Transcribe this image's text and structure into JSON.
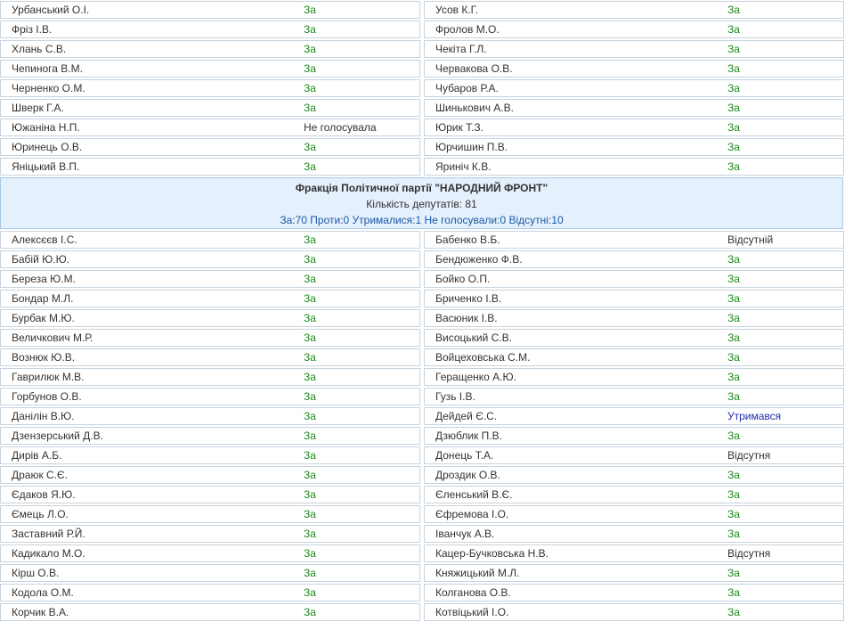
{
  "top_rows": [
    {
      "l_name": "Урбанський О.І.",
      "l_vote": "За",
      "l_type": "yes",
      "r_name": "Усов К.Г.",
      "r_vote": "За",
      "r_type": "yes"
    },
    {
      "l_name": "Фріз І.В.",
      "l_vote": "За",
      "l_type": "yes",
      "r_name": "Фролов М.О.",
      "r_vote": "За",
      "r_type": "yes"
    },
    {
      "l_name": "Хлань С.В.",
      "l_vote": "За",
      "l_type": "yes",
      "r_name": "Чекіта Г.Л.",
      "r_vote": "За",
      "r_type": "yes"
    },
    {
      "l_name": "Чепинога В.М.",
      "l_vote": "За",
      "l_type": "yes",
      "r_name": "Червакова О.В.",
      "r_vote": "За",
      "r_type": "yes"
    },
    {
      "l_name": "Черненко О.М.",
      "l_vote": "За",
      "l_type": "yes",
      "r_name": "Чубаров Р.А.",
      "r_vote": "За",
      "r_type": "yes"
    },
    {
      "l_name": "Шверк Г.А.",
      "l_vote": "За",
      "l_type": "yes",
      "r_name": "Шинькович А.В.",
      "r_vote": "За",
      "r_type": "yes"
    },
    {
      "l_name": "Южаніна Н.П.",
      "l_vote": "Не голосувала",
      "l_type": "none",
      "r_name": "Юрик Т.З.",
      "r_vote": "За",
      "r_type": "yes"
    },
    {
      "l_name": "Юринець О.В.",
      "l_vote": "За",
      "l_type": "yes",
      "r_name": "Юрчишин П.В.",
      "r_vote": "За",
      "r_type": "yes"
    },
    {
      "l_name": "Яніцький В.П.",
      "l_vote": "За",
      "l_type": "yes",
      "r_name": "Яриніч К.В.",
      "r_vote": "За",
      "r_type": "yes"
    }
  ],
  "faction": {
    "title": "Фракція Політичної партії \"НАРОДНИЙ ФРОНТ\"",
    "count": "Кількість депутатів: 81",
    "summary": "За:70 Проти:0 Утрималися:1 Не голосували:0 Відсутні:10"
  },
  "bottom_rows": [
    {
      "l_name": "Алексєєв І.С.",
      "l_vote": "За",
      "l_type": "yes",
      "r_name": "Бабенко В.Б.",
      "r_vote": "Відсутній",
      "r_type": "absent"
    },
    {
      "l_name": "Бабій Ю.Ю.",
      "l_vote": "За",
      "l_type": "yes",
      "r_name": "Бендюженко Ф.В.",
      "r_vote": "За",
      "r_type": "yes"
    },
    {
      "l_name": "Береза Ю.М.",
      "l_vote": "За",
      "l_type": "yes",
      "r_name": "Бойко О.П.",
      "r_vote": "За",
      "r_type": "yes"
    },
    {
      "l_name": "Бондар М.Л.",
      "l_vote": "За",
      "l_type": "yes",
      "r_name": "Бриченко І.В.",
      "r_vote": "За",
      "r_type": "yes"
    },
    {
      "l_name": "Бурбак М.Ю.",
      "l_vote": "За",
      "l_type": "yes",
      "r_name": "Васюник І.В.",
      "r_vote": "За",
      "r_type": "yes"
    },
    {
      "l_name": "Величкович М.Р.",
      "l_vote": "За",
      "l_type": "yes",
      "r_name": "Висоцький С.В.",
      "r_vote": "За",
      "r_type": "yes"
    },
    {
      "l_name": "Вознюк Ю.В.",
      "l_vote": "За",
      "l_type": "yes",
      "r_name": "Войцеховська С.М.",
      "r_vote": "За",
      "r_type": "yes"
    },
    {
      "l_name": "Гаврилюк М.В.",
      "l_vote": "За",
      "l_type": "yes",
      "r_name": "Геращенко А.Ю.",
      "r_vote": "За",
      "r_type": "yes"
    },
    {
      "l_name": "Горбунов О.В.",
      "l_vote": "За",
      "l_type": "yes",
      "r_name": "Гузь І.В.",
      "r_vote": "За",
      "r_type": "yes"
    },
    {
      "l_name": "Данілін В.Ю.",
      "l_vote": "За",
      "l_type": "yes",
      "r_name": "Дейдей Є.С.",
      "r_vote": "Утримався",
      "r_type": "abstain"
    },
    {
      "l_name": "Дзензерський Д.В.",
      "l_vote": "За",
      "l_type": "yes",
      "r_name": "Дзюблик П.В.",
      "r_vote": "За",
      "r_type": "yes"
    },
    {
      "l_name": "Дирів А.Б.",
      "l_vote": "За",
      "l_type": "yes",
      "r_name": "Донець Т.А.",
      "r_vote": "Відсутня",
      "r_type": "absent"
    },
    {
      "l_name": "Драюк С.Є.",
      "l_vote": "За",
      "l_type": "yes",
      "r_name": "Дроздик О.В.",
      "r_vote": "За",
      "r_type": "yes"
    },
    {
      "l_name": "Єдаков Я.Ю.",
      "l_vote": "За",
      "l_type": "yes",
      "r_name": "Єленський В.Є.",
      "r_vote": "За",
      "r_type": "yes"
    },
    {
      "l_name": "Ємець Л.О.",
      "l_vote": "За",
      "l_type": "yes",
      "r_name": "Єфремова І.О.",
      "r_vote": "За",
      "r_type": "yes"
    },
    {
      "l_name": "Заставний Р.Й.",
      "l_vote": "За",
      "l_type": "yes",
      "r_name": "Іванчук А.В.",
      "r_vote": "За",
      "r_type": "yes"
    },
    {
      "l_name": "Кадикало М.О.",
      "l_vote": "За",
      "l_type": "yes",
      "r_name": "Кацер-Бучковська Н.В.",
      "r_vote": "Відсутня",
      "r_type": "absent"
    },
    {
      "l_name": "Кірш О.В.",
      "l_vote": "За",
      "l_type": "yes",
      "r_name": "Княжицький М.Л.",
      "r_vote": "За",
      "r_type": "yes"
    },
    {
      "l_name": "Кодола О.М.",
      "l_vote": "За",
      "l_type": "yes",
      "r_name": "Колганова О.В.",
      "r_vote": "За",
      "r_type": "yes"
    },
    {
      "l_name": "Корчик В.А.",
      "l_vote": "За",
      "l_type": "yes",
      "r_name": "Котвіцький І.О.",
      "r_vote": "За",
      "r_type": "yes"
    }
  ],
  "colors": {
    "vote_yes": "#1a8a1a",
    "vote_abstain": "#1f2fb0",
    "vote_absent": "#333333",
    "cell_border": "#c6d3df",
    "faction_bg": "#e4f0fb",
    "faction_summary": "#1a58a8"
  }
}
